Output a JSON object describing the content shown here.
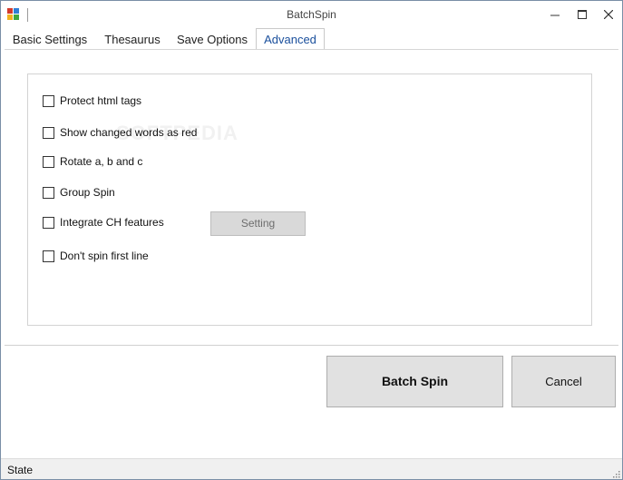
{
  "window": {
    "title": "BatchSpin"
  },
  "tabs": [
    {
      "label": "Basic Settings",
      "active": false
    },
    {
      "label": "Thesaurus",
      "active": false
    },
    {
      "label": "Save Options",
      "active": false
    },
    {
      "label": "Advanced",
      "active": true
    }
  ],
  "options": [
    {
      "label": "Protect html tags",
      "checked": false
    },
    {
      "label": "Show changed words as red",
      "checked": false
    },
    {
      "label": "Rotate a, b and c",
      "checked": false
    },
    {
      "label": "Group Spin",
      "checked": false
    },
    {
      "label": "Integrate CH features",
      "checked": false
    },
    {
      "label": "Don't spin first line",
      "checked": false
    }
  ],
  "buttons": {
    "setting": "Setting",
    "batch_spin": "Batch Spin",
    "cancel": "Cancel"
  },
  "status": {
    "text": "State"
  },
  "watermark": "SOFTPEDIA",
  "icons": {
    "app": "app-icon",
    "minimize": "minimize-icon",
    "maximize": "maximize-icon",
    "close": "close-icon",
    "grip": "resize-grip-icon"
  },
  "colors": {
    "active_tab_text": "#1a4f9c",
    "button_face": "#e1e1e1",
    "window_border": "#7a8ea6"
  }
}
